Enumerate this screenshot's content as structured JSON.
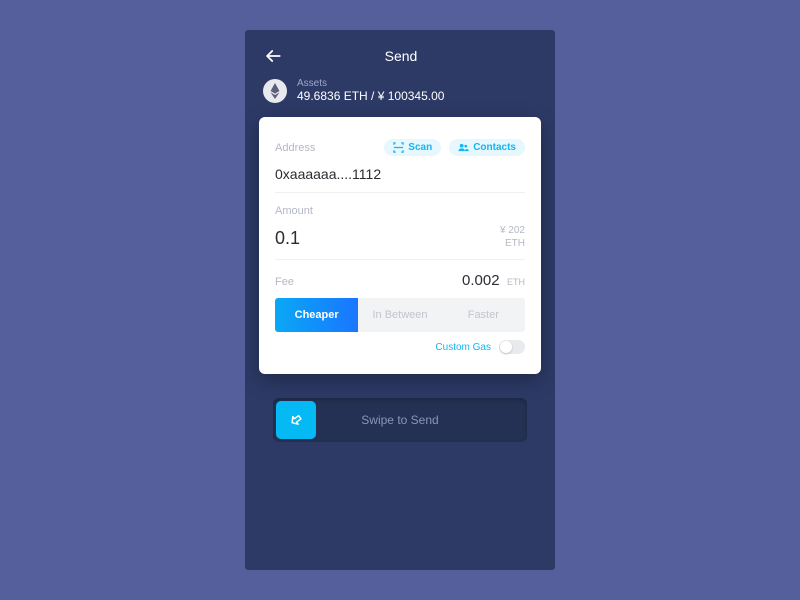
{
  "header": {
    "title": "Send"
  },
  "assets": {
    "label": "Assets",
    "value": "49.6836 ETH / ¥ 100345.00"
  },
  "address": {
    "label": "Address",
    "value": "0xaaaaaa....1112",
    "scan_label": "Scan",
    "contacts_label": "Contacts"
  },
  "amount": {
    "label": "Amount",
    "value": "0.1",
    "fiat": "¥ 202",
    "unit": "ETH"
  },
  "fee": {
    "label": "Fee",
    "value": "0.002",
    "unit": "ETH",
    "options": [
      "Cheaper",
      "In Between",
      "Faster"
    ],
    "active": "Cheaper",
    "custom_label": "Custom Gas"
  },
  "swipe": {
    "label": "Swipe to Send"
  },
  "colors": {
    "accent": "#0aa8f5"
  }
}
